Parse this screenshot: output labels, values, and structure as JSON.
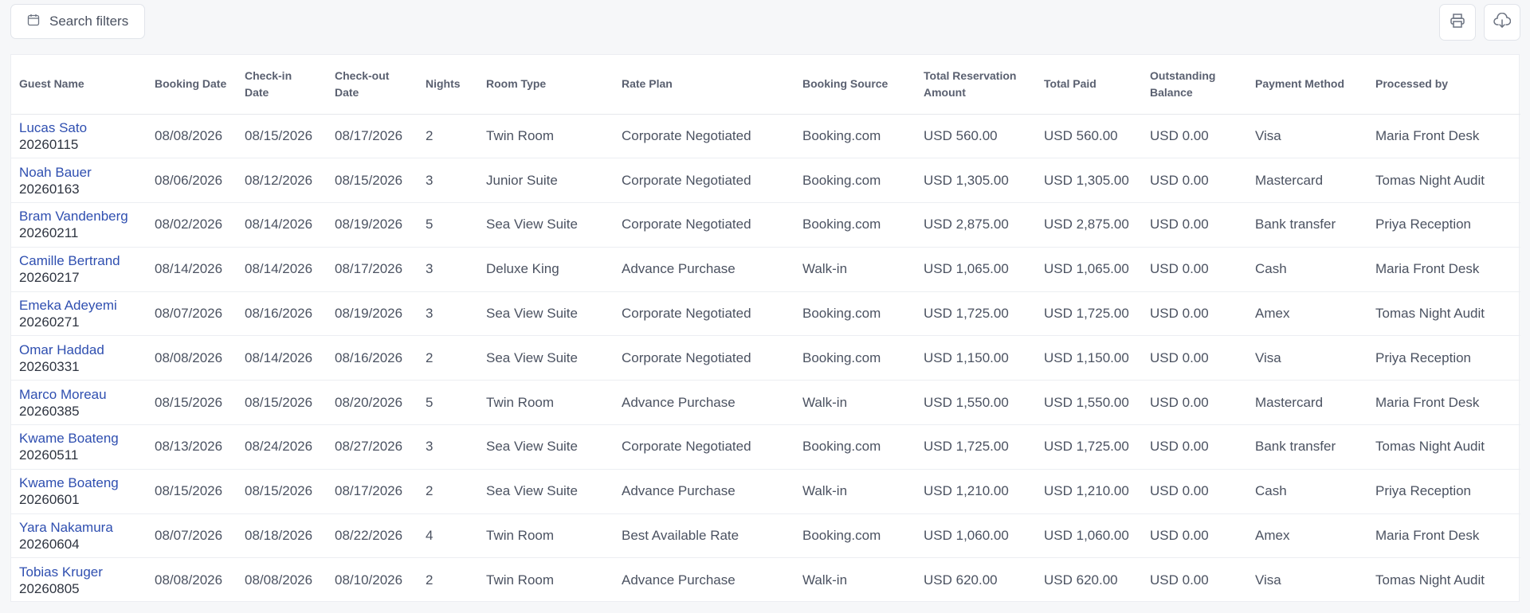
{
  "toolbar": {
    "search_filters_label": "Search filters",
    "print_icon": "printer-icon",
    "download_icon": "cloud-download-icon",
    "calendar_icon": "calendar-icon"
  },
  "table": {
    "headers": [
      "Guest Name",
      "Booking Date",
      "Check-in Date",
      "Check-out Date",
      "Nights",
      "Room Type",
      "Rate Plan",
      "Booking Source",
      "Total Reservation Amount",
      "Total Paid",
      "Outstanding Balance",
      "Payment Method",
      "Processed by"
    ],
    "rows": [
      {
        "name": "Lucas Sato",
        "id": "20260115",
        "booking": "08/08/2026",
        "checkin": "08/15/2026",
        "checkout": "08/17/2026",
        "nights": "2",
        "room": "Twin Room",
        "rate": "Corporate Negotiated",
        "source": "Booking.com",
        "total": "USD 560.00",
        "paid": "USD 560.00",
        "balance": "USD 0.00",
        "payment": "Visa",
        "processed": "Maria Front Desk"
      },
      {
        "name": "Noah Bauer",
        "id": "20260163",
        "booking": "08/06/2026",
        "checkin": "08/12/2026",
        "checkout": "08/15/2026",
        "nights": "3",
        "room": "Junior Suite",
        "rate": "Corporate Negotiated",
        "source": "Booking.com",
        "total": "USD 1,305.00",
        "paid": "USD 1,305.00",
        "balance": "USD 0.00",
        "payment": "Mastercard",
        "processed": "Tomas Night Audit"
      },
      {
        "name": "Bram Vandenberg",
        "id": "20260211",
        "booking": "08/02/2026",
        "checkin": "08/14/2026",
        "checkout": "08/19/2026",
        "nights": "5",
        "room": "Sea View Suite",
        "rate": "Corporate Negotiated",
        "source": "Booking.com",
        "total": "USD 2,875.00",
        "paid": "USD 2,875.00",
        "balance": "USD 0.00",
        "payment": "Bank transfer",
        "processed": "Priya Reception"
      },
      {
        "name": "Camille Bertrand",
        "id": "20260217",
        "booking": "08/14/2026",
        "checkin": "08/14/2026",
        "checkout": "08/17/2026",
        "nights": "3",
        "room": "Deluxe King",
        "rate": "Advance Purchase",
        "source": "Walk-in",
        "total": "USD 1,065.00",
        "paid": "USD 1,065.00",
        "balance": "USD 0.00",
        "payment": "Cash",
        "processed": "Maria Front Desk"
      },
      {
        "name": "Emeka Adeyemi",
        "id": "20260271",
        "booking": "08/07/2026",
        "checkin": "08/16/2026",
        "checkout": "08/19/2026",
        "nights": "3",
        "room": "Sea View Suite",
        "rate": "Corporate Negotiated",
        "source": "Booking.com",
        "total": "USD 1,725.00",
        "paid": "USD 1,725.00",
        "balance": "USD 0.00",
        "payment": "Amex",
        "processed": "Tomas Night Audit"
      },
      {
        "name": "Omar Haddad",
        "id": "20260331",
        "booking": "08/08/2026",
        "checkin": "08/14/2026",
        "checkout": "08/16/2026",
        "nights": "2",
        "room": "Sea View Suite",
        "rate": "Corporate Negotiated",
        "source": "Booking.com",
        "total": "USD 1,150.00",
        "paid": "USD 1,150.00",
        "balance": "USD 0.00",
        "payment": "Visa",
        "processed": "Priya Reception"
      },
      {
        "name": "Marco Moreau",
        "id": "20260385",
        "booking": "08/15/2026",
        "checkin": "08/15/2026",
        "checkout": "08/20/2026",
        "nights": "5",
        "room": "Twin Room",
        "rate": "Advance Purchase",
        "source": "Walk-in",
        "total": "USD 1,550.00",
        "paid": "USD 1,550.00",
        "balance": "USD 0.00",
        "payment": "Mastercard",
        "processed": "Maria Front Desk"
      },
      {
        "name": "Kwame Boateng",
        "id": "20260511",
        "booking": "08/13/2026",
        "checkin": "08/24/2026",
        "checkout": "08/27/2026",
        "nights": "3",
        "room": "Sea View Suite",
        "rate": "Corporate Negotiated",
        "source": "Booking.com",
        "total": "USD 1,725.00",
        "paid": "USD 1,725.00",
        "balance": "USD 0.00",
        "payment": "Bank transfer",
        "processed": "Tomas Night Audit"
      },
      {
        "name": "Kwame Boateng",
        "id": "20260601",
        "booking": "08/15/2026",
        "checkin": "08/15/2026",
        "checkout": "08/17/2026",
        "nights": "2",
        "room": "Sea View Suite",
        "rate": "Advance Purchase",
        "source": "Walk-in",
        "total": "USD 1,210.00",
        "paid": "USD 1,210.00",
        "balance": "USD 0.00",
        "payment": "Cash",
        "processed": "Priya Reception"
      },
      {
        "name": "Yara Nakamura",
        "id": "20260604",
        "booking": "08/07/2026",
        "checkin": "08/18/2026",
        "checkout": "08/22/2026",
        "nights": "4",
        "room": "Twin Room",
        "rate": "Best Available Rate",
        "source": "Booking.com",
        "total": "USD 1,060.00",
        "paid": "USD 1,060.00",
        "balance": "USD 0.00",
        "payment": "Amex",
        "processed": "Maria Front Desk"
      },
      {
        "name": "Tobias Kruger",
        "id": "20260805",
        "booking": "08/08/2026",
        "checkin": "08/08/2026",
        "checkout": "08/10/2026",
        "nights": "2",
        "room": "Twin Room",
        "rate": "Advance Purchase",
        "source": "Walk-in",
        "total": "USD 620.00",
        "paid": "USD 620.00",
        "balance": "USD 0.00",
        "payment": "Visa",
        "processed": "Tomas Night Audit"
      }
    ]
  }
}
